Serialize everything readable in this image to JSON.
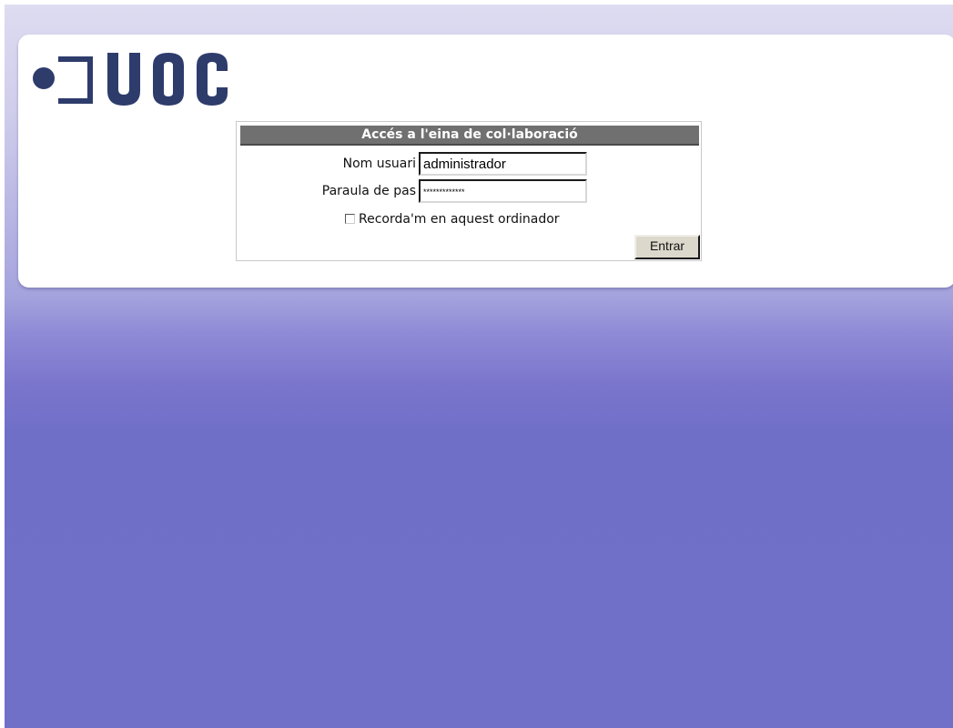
{
  "brand": {
    "logo_text": "UOC",
    "logo_color": "#2e3c6c"
  },
  "login": {
    "title": "Accés a l'eina de col·laboració",
    "username_label": "Nom usuari",
    "username_value": "administrador",
    "password_label": "Paraula de pas",
    "password_value": "*************",
    "remember_label": "Recorda'm en aquest ordinador",
    "remember_checked": false,
    "submit_label": "Entrar"
  },
  "colors": {
    "background_gradient_top": "#dedcf1",
    "background_gradient_bottom": "#7070c8",
    "title_bar": "#707070"
  }
}
